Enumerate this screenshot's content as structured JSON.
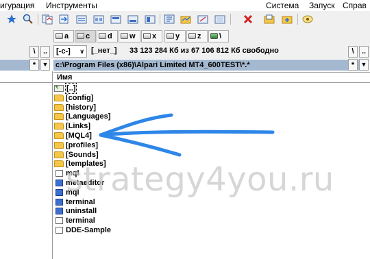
{
  "menu": [
    "игурация",
    "Инструменты",
    "Система",
    "Запуск",
    "Справ"
  ],
  "toolbar_icons": [
    "star-icon",
    "search-icon",
    "copy-icon",
    "move-icon",
    "folder-icon",
    "folder-icon",
    "folder-icon",
    "folder-icon",
    "folder-icon",
    "tools-icon",
    "folder-icon",
    "folder-icon",
    "folder-icon",
    "delete-icon",
    "folder-icon",
    "folder-icon",
    "view-icon"
  ],
  "drives": [
    "a",
    "c",
    "d",
    "w",
    "x",
    "y",
    "z",
    "\\"
  ],
  "path_row": {
    "left_sep": "\\",
    "left_dots": "..",
    "drive_select": "[-c-]",
    "volume": "[_нет_]",
    "free_space": "33 123 284 Кб из 67 106 812 Кб свободно",
    "sep": "\\",
    "dots": ".."
  },
  "current_path": "c:\\Program Files (x86)\\Alpari Limited MT4_600TEST\\*.*",
  "left_star": "*",
  "right_star": "*",
  "column_name": "Имя",
  "files": [
    {
      "name": "[..]",
      "type": "up"
    },
    {
      "name": "[config]",
      "type": "folder"
    },
    {
      "name": "[history]",
      "type": "folder"
    },
    {
      "name": "[Languages]",
      "type": "folder"
    },
    {
      "name": "[Links]",
      "type": "folder"
    },
    {
      "name": "[MQL4]",
      "type": "folder"
    },
    {
      "name": "[profiles]",
      "type": "folder"
    },
    {
      "name": "[Sounds]",
      "type": "folder"
    },
    {
      "name": "[templates]",
      "type": "folder"
    },
    {
      "name": "mql",
      "type": "doc"
    },
    {
      "name": "metaeditor",
      "type": "exe"
    },
    {
      "name": "mql",
      "type": "exe"
    },
    {
      "name": "terminal",
      "type": "exe"
    },
    {
      "name": "uninstall",
      "type": "exe"
    },
    {
      "name": "terminal",
      "type": "doc"
    },
    {
      "name": "DDE-Sample",
      "type": "doc"
    }
  ],
  "watermark": "strategy4you.ru",
  "colors": {
    "path_highlight": "#a4b8d0",
    "arrow": "#2e86e8",
    "folder": "#f4c64a"
  }
}
